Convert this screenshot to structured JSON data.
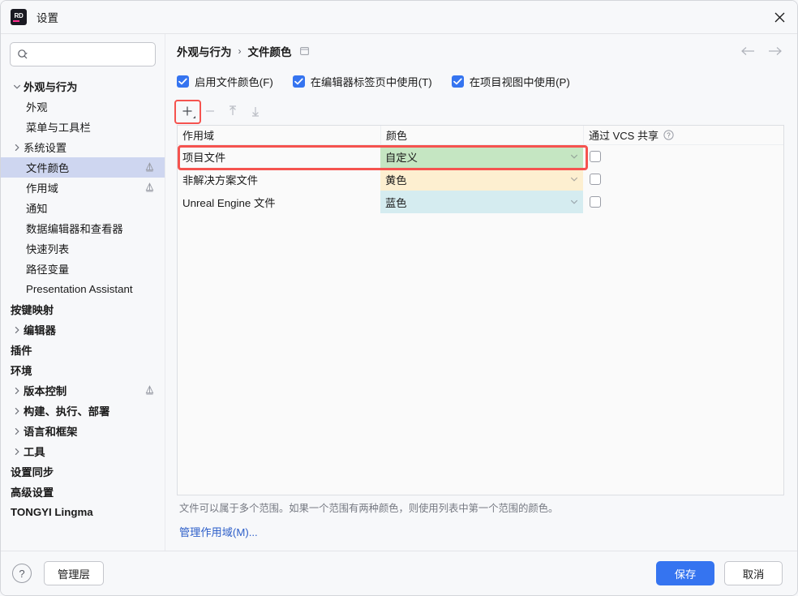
{
  "window": {
    "app_icon": "rider-logo-icon",
    "title": "设置",
    "close_icon": "close-icon"
  },
  "sidebar": {
    "search": {
      "placeholder": "",
      "value": "",
      "icon": "search-icon"
    },
    "items": [
      {
        "label": "外观与行为",
        "depth": 0,
        "bold": true,
        "chevron": "down",
        "badge": false,
        "selected": false,
        "name": "appearance-behavior"
      },
      {
        "label": "外观",
        "depth": 1,
        "bold": false,
        "chevron": "none",
        "badge": false,
        "selected": false,
        "name": "appearance"
      },
      {
        "label": "菜单与工具栏",
        "depth": 1,
        "bold": false,
        "chevron": "none",
        "badge": false,
        "selected": false,
        "name": "menus-toolbars"
      },
      {
        "label": "系统设置",
        "depth": 1,
        "bold": false,
        "chevron": "right",
        "badge": false,
        "selected": false,
        "name": "system-settings"
      },
      {
        "label": "文件颜色",
        "depth": 1,
        "bold": false,
        "chevron": "none",
        "badge": true,
        "selected": true,
        "name": "file-colors"
      },
      {
        "label": "作用域",
        "depth": 1,
        "bold": false,
        "chevron": "none",
        "badge": true,
        "selected": false,
        "name": "scopes"
      },
      {
        "label": "通知",
        "depth": 1,
        "bold": false,
        "chevron": "none",
        "badge": false,
        "selected": false,
        "name": "notifications"
      },
      {
        "label": "数据编辑器和查看器",
        "depth": 1,
        "bold": false,
        "chevron": "none",
        "badge": false,
        "selected": false,
        "name": "data-editor-viewer"
      },
      {
        "label": "快速列表",
        "depth": 1,
        "bold": false,
        "chevron": "none",
        "badge": false,
        "selected": false,
        "name": "quick-lists"
      },
      {
        "label": "路径变量",
        "depth": 1,
        "bold": false,
        "chevron": "none",
        "badge": false,
        "selected": false,
        "name": "path-variables"
      },
      {
        "label": "Presentation Assistant",
        "depth": 1,
        "bold": false,
        "chevron": "none",
        "badge": false,
        "selected": false,
        "latin": true,
        "name": "presentation-assistant"
      },
      {
        "label": "按键映射",
        "depth": 0,
        "bold": true,
        "chevron": "none",
        "badge": false,
        "selected": false,
        "name": "keymap"
      },
      {
        "label": "编辑器",
        "depth": 0,
        "bold": true,
        "chevron": "right",
        "badge": false,
        "selected": false,
        "name": "editor"
      },
      {
        "label": "插件",
        "depth": 0,
        "bold": true,
        "chevron": "none",
        "badge": false,
        "selected": false,
        "name": "plugins"
      },
      {
        "label": "环境",
        "depth": 0,
        "bold": true,
        "chevron": "none",
        "badge": false,
        "selected": false,
        "name": "environment"
      },
      {
        "label": "版本控制",
        "depth": 0,
        "bold": true,
        "chevron": "right",
        "badge": true,
        "selected": false,
        "name": "version-control"
      },
      {
        "label": "构建、执行、部署",
        "depth": 0,
        "bold": true,
        "chevron": "right",
        "badge": false,
        "selected": false,
        "name": "build-execution-deployment"
      },
      {
        "label": "语言和框架",
        "depth": 0,
        "bold": true,
        "chevron": "right",
        "badge": false,
        "selected": false,
        "name": "languages-frameworks"
      },
      {
        "label": "工具",
        "depth": 0,
        "bold": true,
        "chevron": "right",
        "badge": false,
        "selected": false,
        "name": "tools"
      },
      {
        "label": "设置同步",
        "depth": 0,
        "bold": true,
        "chevron": "none",
        "badge": false,
        "selected": false,
        "name": "settings-sync"
      },
      {
        "label": "高级设置",
        "depth": 0,
        "bold": true,
        "chevron": "none",
        "badge": false,
        "selected": false,
        "name": "advanced-settings"
      },
      {
        "label": "TONGYI Lingma",
        "depth": 0,
        "bold": true,
        "chevron": "none",
        "badge": false,
        "selected": false,
        "latin": true,
        "name": "tongyi-lingma"
      }
    ]
  },
  "main": {
    "breadcrumb": {
      "parent": "外观与行为",
      "separator": "›",
      "current": "文件颜色",
      "trailing_icon": "window-icon"
    },
    "nav": {
      "back_icon": "arrow-left-icon",
      "forward_icon": "arrow-right-icon"
    },
    "checkboxes": [
      {
        "label": "启用文件颜色(F)",
        "checked": true,
        "name": "enable-file-colors-checkbox"
      },
      {
        "label": "在编辑器标签页中使用(T)",
        "checked": true,
        "name": "use-in-editor-tabs-checkbox"
      },
      {
        "label": "在项目视图中使用(P)",
        "checked": true,
        "name": "use-in-project-view-checkbox"
      }
    ],
    "toolbar": [
      {
        "icon": "plus-icon",
        "enabled": true,
        "highlighted": true,
        "has_dropdown": true,
        "name": "add-button"
      },
      {
        "icon": "minus-icon",
        "enabled": false,
        "highlighted": false,
        "has_dropdown": false,
        "name": "remove-button"
      },
      {
        "icon": "arrow-up-icon",
        "enabled": false,
        "highlighted": false,
        "has_dropdown": false,
        "name": "move-up-button"
      },
      {
        "icon": "arrow-down-icon",
        "enabled": false,
        "highlighted": false,
        "has_dropdown": false,
        "name": "move-down-button"
      }
    ],
    "table": {
      "columns": [
        "作用域",
        "颜色",
        "通过 VCS 共享"
      ],
      "vcs_help_icon": "question-circle-icon",
      "rows": [
        {
          "scope": "项目文件",
          "color_label": "自定义",
          "color_bg": "#c5e6c2",
          "vcs_shared": false,
          "highlighted": true,
          "name": "row-project-files"
        },
        {
          "scope": "非解决方案文件",
          "color_label": "黄色",
          "color_bg": "#fdefd0",
          "vcs_shared": false,
          "highlighted": false,
          "name": "row-non-solution-files"
        },
        {
          "scope": "Unreal Engine 文件",
          "color_label": "蓝色",
          "color_bg": "#d5ecf0",
          "vcs_shared": false,
          "highlighted": false,
          "name": "row-unreal-engine-files"
        }
      ]
    },
    "note": "文件可以属于多个范围。如果一个范围有两种颜色，则使用列表中第一个范围的颜色。",
    "manage_scopes_link": "管理作用域(M)..."
  },
  "footer": {
    "help_icon": "question-mark-icon",
    "manage_layers_label": "管理层",
    "save_label": "保存",
    "cancel_label": "取消"
  },
  "colors": {
    "accent": "#3574f0",
    "highlight_red": "#f5534f",
    "selection_blue": "#ced6f0",
    "link_blue": "#2e5fc9"
  }
}
